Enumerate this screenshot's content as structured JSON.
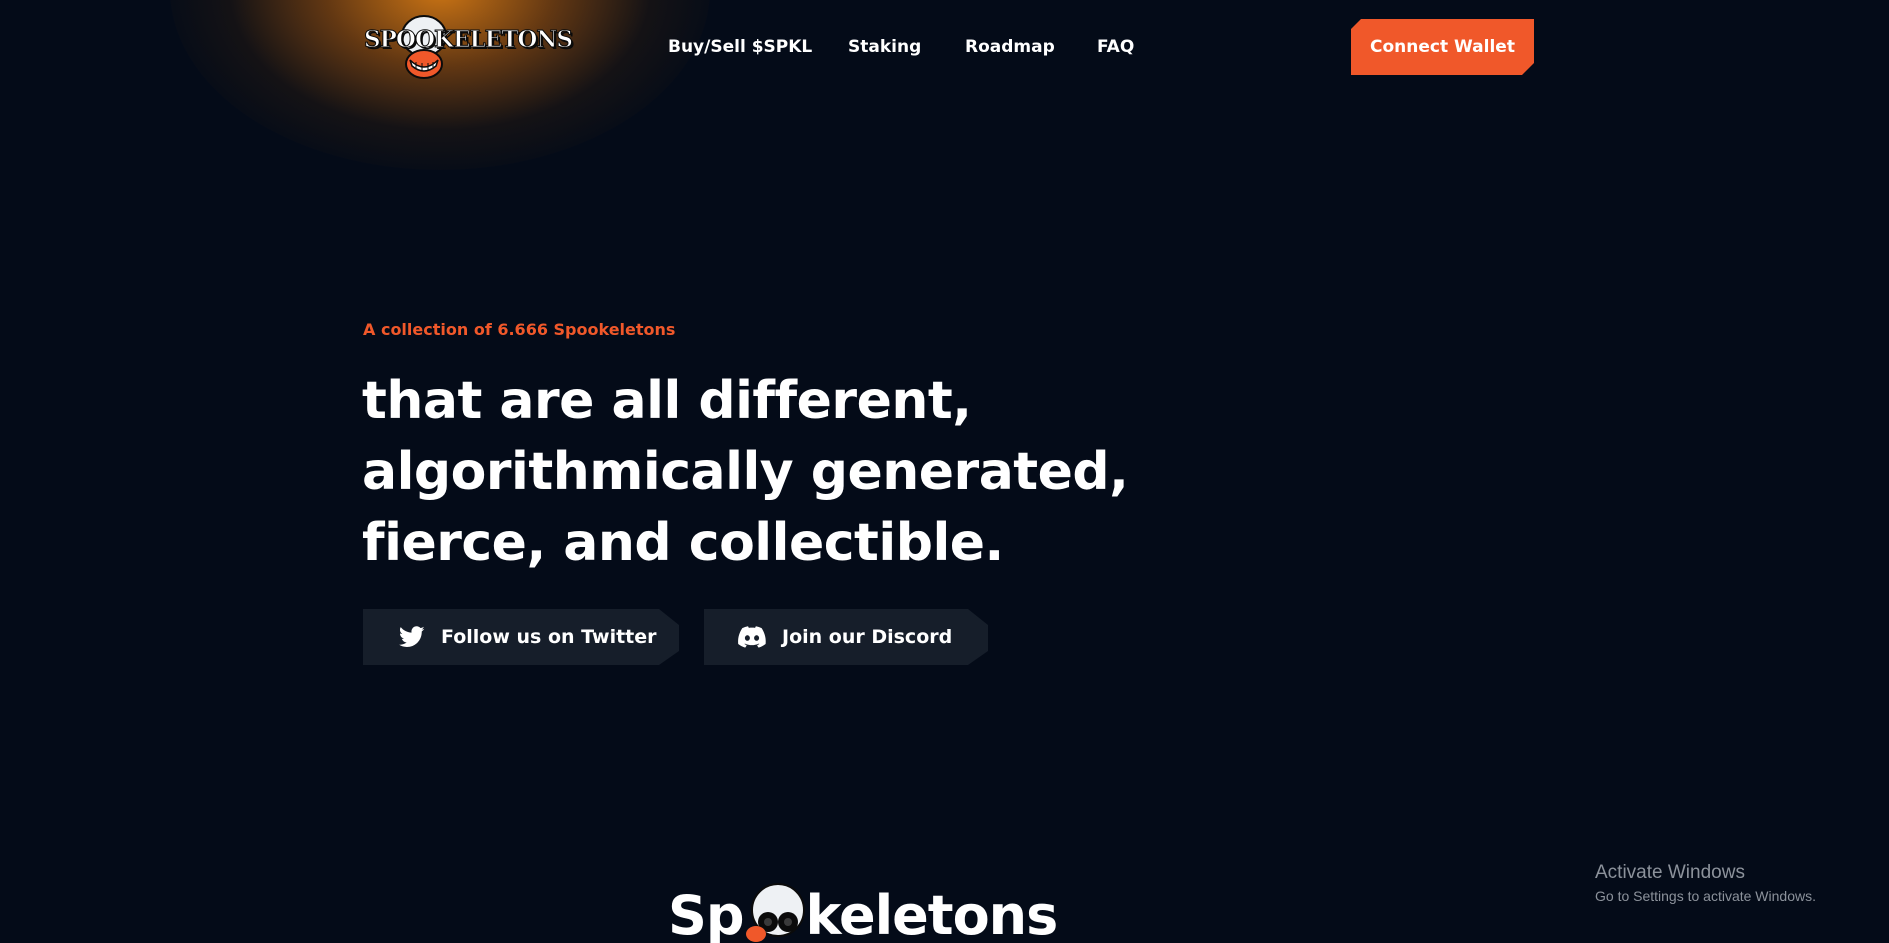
{
  "brand": {
    "logo_text": "SPOOKELETONS",
    "accent_color": "#f0582a",
    "background_color": "#040b18"
  },
  "nav": {
    "items": [
      {
        "label": "Buy/Sell $SPKL"
      },
      {
        "label": "Staking"
      },
      {
        "label": "Roadmap"
      },
      {
        "label": "FAQ"
      }
    ],
    "connect_label": "Connect Wallet"
  },
  "hero": {
    "eyebrow": "A collection of 6.666 Spookeletons",
    "headline_lines": [
      "that are all different,",
      "algorithmically generated,",
      "fierce, and collectible."
    ],
    "twitter_label": "Follow us on Twitter",
    "twitter_icon": "twitter-icon",
    "discord_label": "Join our Discord",
    "discord_icon": "discord-icon"
  },
  "section_logo": {
    "part1": "Sp",
    "part2": "keletons"
  },
  "windows_watermark": {
    "title": "Activate Windows",
    "subtitle": "Go to Settings to activate Windows."
  }
}
